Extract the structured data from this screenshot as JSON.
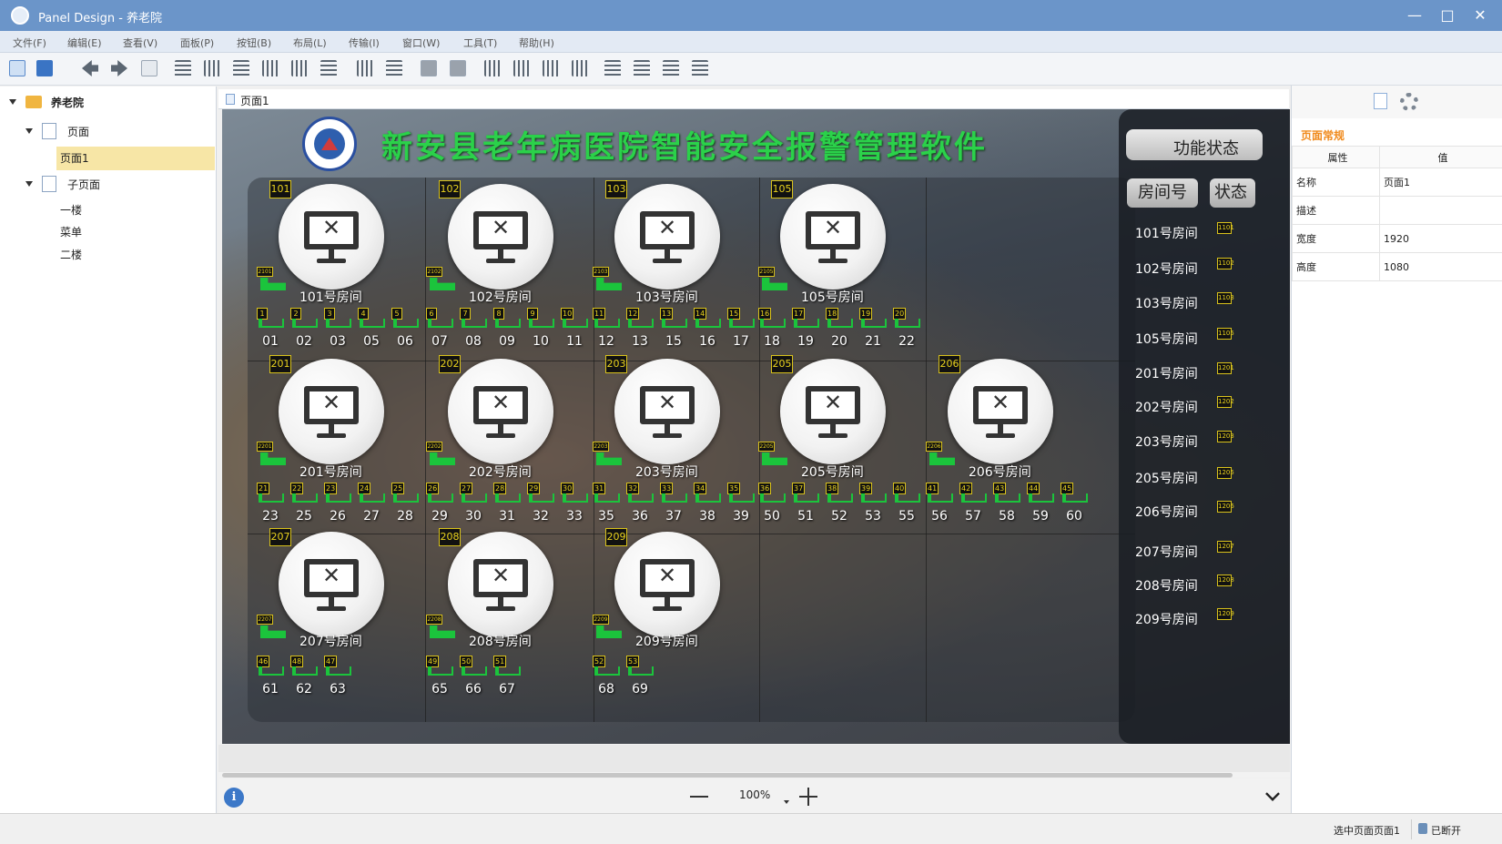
{
  "window": {
    "title": "Panel Design - 养老院"
  },
  "menu": [
    "文件(F)",
    "编辑(E)",
    "查看(V)",
    "面板(P)",
    "按钮(B)",
    "布局(L)",
    "传输(I)",
    "窗口(W)",
    "工具(T)",
    "帮助(H)"
  ],
  "tree": {
    "root": "养老院",
    "pages_group": "页面",
    "page1": "页面1",
    "subpages_group": "子页面",
    "subpages": [
      "一楼",
      "菜单",
      "二楼"
    ]
  },
  "doc_tab": "页面1",
  "canvas": {
    "title": "新安县老年病医院智能安全报警管理软件",
    "rooms": [
      {
        "num": "101",
        "name": "101号房间",
        "sink": "2101",
        "beds": [
          {
            "l": "1",
            "n": "01"
          },
          {
            "l": "2",
            "n": "02"
          },
          {
            "l": "3",
            "n": "03"
          },
          {
            "l": "4",
            "n": "05"
          },
          {
            "l": "5",
            "n": "06"
          }
        ]
      },
      {
        "num": "102",
        "name": "102号房间",
        "sink": "2102",
        "beds": [
          {
            "l": "6",
            "n": "07"
          },
          {
            "l": "7",
            "n": "08"
          },
          {
            "l": "8",
            "n": "09"
          },
          {
            "l": "9",
            "n": "10"
          },
          {
            "l": "10",
            "n": "11"
          }
        ]
      },
      {
        "num": "103",
        "name": "103号房间",
        "sink": "2103",
        "beds": [
          {
            "l": "11",
            "n": "12"
          },
          {
            "l": "12",
            "n": "13"
          },
          {
            "l": "13",
            "n": "15"
          },
          {
            "l": "14",
            "n": "16"
          },
          {
            "l": "15",
            "n": "17"
          }
        ]
      },
      {
        "num": "105",
        "name": "105号房间",
        "sink": "2105",
        "beds": [
          {
            "l": "16",
            "n": "18"
          },
          {
            "l": "17",
            "n": "19"
          },
          {
            "l": "18",
            "n": "20"
          },
          {
            "l": "19",
            "n": "21"
          },
          {
            "l": "20",
            "n": "22"
          }
        ]
      },
      {
        "num": "201",
        "name": "201号房间",
        "sink": "2201",
        "beds": [
          {
            "l": "21",
            "n": "23"
          },
          {
            "l": "22",
            "n": "25"
          },
          {
            "l": "23",
            "n": "26"
          },
          {
            "l": "24",
            "n": "27"
          },
          {
            "l": "25",
            "n": "28"
          }
        ]
      },
      {
        "num": "202",
        "name": "202号房间",
        "sink": "2202",
        "beds": [
          {
            "l": "26",
            "n": "29"
          },
          {
            "l": "27",
            "n": "30"
          },
          {
            "l": "28",
            "n": "31"
          },
          {
            "l": "29",
            "n": "32"
          },
          {
            "l": "30",
            "n": "33"
          }
        ]
      },
      {
        "num": "203",
        "name": "203号房间",
        "sink": "2203",
        "beds": [
          {
            "l": "31",
            "n": "35"
          },
          {
            "l": "32",
            "n": "36"
          },
          {
            "l": "33",
            "n": "37"
          },
          {
            "l": "34",
            "n": "38"
          },
          {
            "l": "35",
            "n": "39"
          }
        ]
      },
      {
        "num": "205",
        "name": "205号房间",
        "sink": "2205",
        "beds": [
          {
            "l": "36",
            "n": "50"
          },
          {
            "l": "37",
            "n": "51"
          },
          {
            "l": "38",
            "n": "52"
          },
          {
            "l": "39",
            "n": "53"
          },
          {
            "l": "40",
            "n": "55"
          }
        ]
      },
      {
        "num": "206",
        "name": "206号房间",
        "sink": "2206",
        "beds": [
          {
            "l": "41",
            "n": "56"
          },
          {
            "l": "42",
            "n": "57"
          },
          {
            "l": "43",
            "n": "58"
          },
          {
            "l": "44",
            "n": "59"
          },
          {
            "l": "45",
            "n": "60"
          }
        ]
      },
      {
        "num": "207",
        "name": "207号房间",
        "sink": "2207",
        "beds": [
          {
            "l": "46",
            "n": "61"
          },
          {
            "l": "48",
            "n": "62"
          },
          {
            "l": "47",
            "n": "63"
          }
        ]
      },
      {
        "num": "208",
        "name": "208号房间",
        "sink": "2208",
        "beds": [
          {
            "l": "49",
            "n": "65"
          },
          {
            "l": "50",
            "n": "66"
          },
          {
            "l": "51",
            "n": "67"
          }
        ]
      },
      {
        "num": "209",
        "name": "209号房间",
        "sink": "2209",
        "beds": [
          {
            "l": "52",
            "n": "68"
          },
          {
            "l": "53",
            "n": "69"
          }
        ]
      }
    ],
    "side": {
      "func_button": "功能状态",
      "room_button": "房间号",
      "status_button": "状态",
      "rooms": [
        {
          "name": "101号房间",
          "tag": "1101"
        },
        {
          "name": "102号房间",
          "tag": "1102"
        },
        {
          "name": "103号房间",
          "tag": "1103"
        },
        {
          "name": "105号房间",
          "tag": "1105"
        },
        {
          "name": "201号房间",
          "tag": "1201"
        },
        {
          "name": "202号房间",
          "tag": "1202"
        },
        {
          "name": "203号房间",
          "tag": "1203"
        },
        {
          "name": "205号房间",
          "tag": "1205"
        },
        {
          "name": "206号房间",
          "tag": "1206"
        },
        {
          "name": "207号房间",
          "tag": "1207"
        },
        {
          "name": "208号房间",
          "tag": "1208"
        },
        {
          "name": "209号房间",
          "tag": "1209"
        }
      ]
    }
  },
  "zoom": {
    "value": "100%"
  },
  "properties": {
    "section": "页面常规",
    "col_attr": "属性",
    "col_val": "值",
    "rows": [
      {
        "k": "名称",
        "v": "页面1"
      },
      {
        "k": "描述",
        "v": ""
      },
      {
        "k": "宽度",
        "v": "1920"
      },
      {
        "k": "高度",
        "v": "1080"
      }
    ]
  },
  "status": {
    "selection": "选中页面页面1",
    "connection": "已断开"
  }
}
